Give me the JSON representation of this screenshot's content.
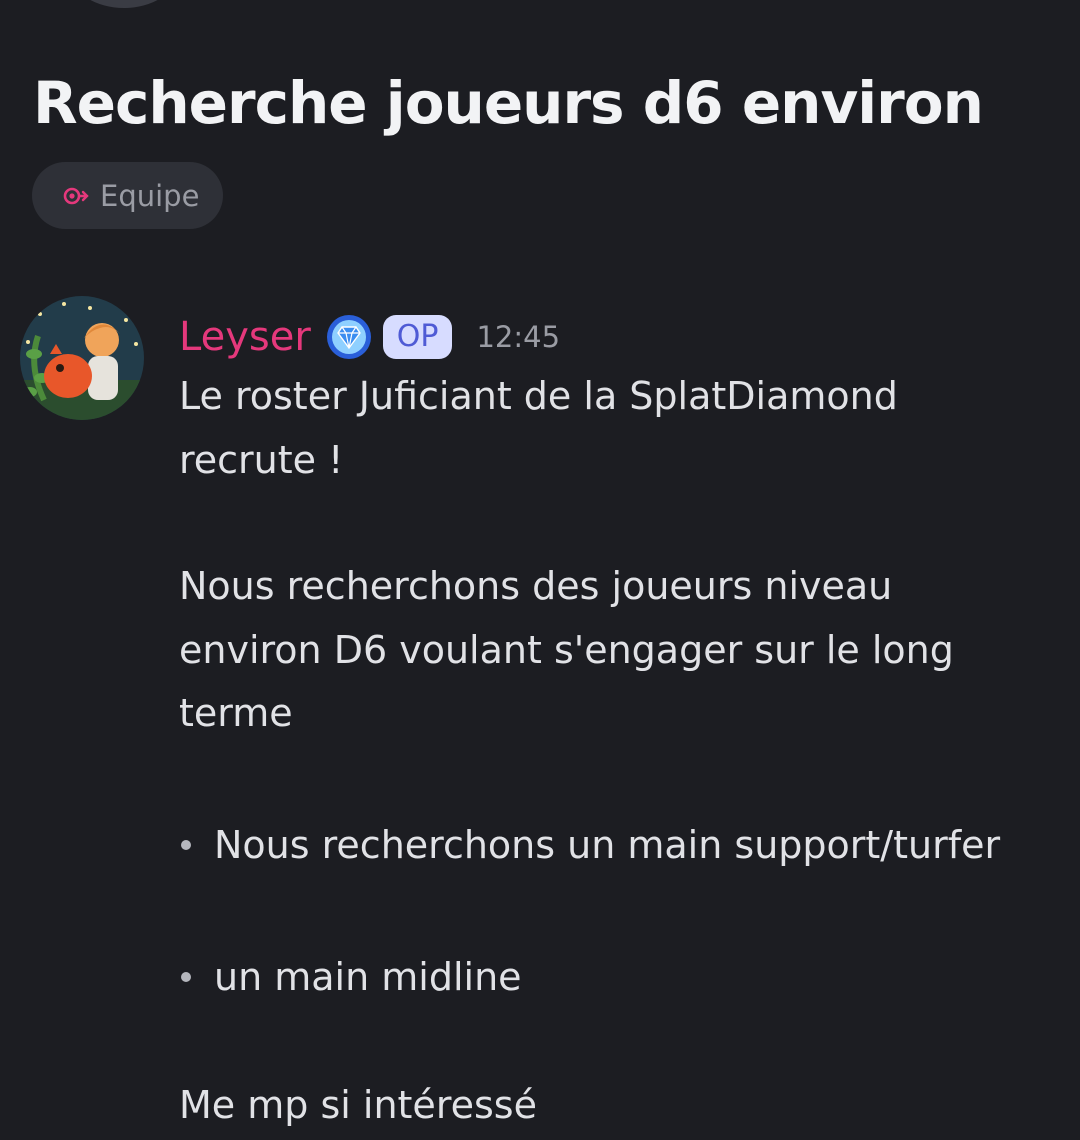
{
  "thread": {
    "title": "Recherche joueurs d6 environ",
    "tag": {
      "label": "Equipe",
      "icon": "team-tag-icon",
      "icon_color": "#e5387c"
    }
  },
  "post": {
    "author": {
      "name": "Leyser",
      "name_color": "#e5387c",
      "avatar_icon": "user-avatar",
      "role_icon": "diamond-emblem-icon",
      "op_badge": "OP"
    },
    "timestamp": "12:45",
    "body": {
      "intro_line_1": "Le roster Juficiant de la SplatDiamond",
      "intro_line_2": "recrute !",
      "para_line_1": "Nous recherchons des joueurs niveau",
      "para_line_2": "environ D6 voulant s'engager sur le long",
      "para_line_3": "terme",
      "bullets": [
        "Nous recherchons un main support/turfer",
        "un main midline"
      ],
      "closing": "Me mp si intéressé"
    }
  },
  "colors": {
    "background": "#1c1d22",
    "chip_background": "#2e3037",
    "text": "#e1e2e6",
    "muted": "#9a9ca4",
    "op_badge_bg": "#d7dcff",
    "op_badge_text": "#4f5bd5"
  }
}
